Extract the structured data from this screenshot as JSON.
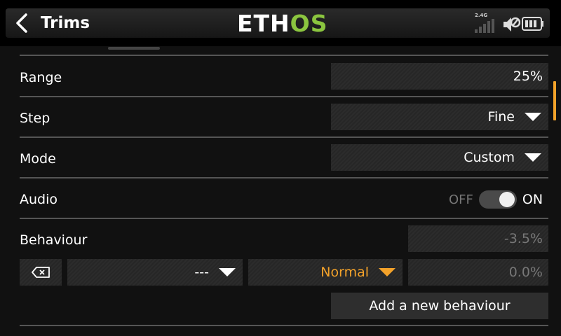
{
  "header": {
    "title": "Trims",
    "logo_eth": "ETH",
    "logo_os": "OS",
    "signal_label": "2.4G",
    "back_icon": "chevron-left-icon",
    "speaker_icon": "speaker-muted-icon",
    "battery_icon": "battery-icon"
  },
  "rows": {
    "range": {
      "label": "Range",
      "value": "25%"
    },
    "step": {
      "label": "Step",
      "value": "Fine"
    },
    "mode": {
      "label": "Mode",
      "value": "Custom"
    },
    "audio": {
      "label": "Audio",
      "off_label": "OFF",
      "on_label": "ON",
      "state": "on"
    },
    "behaviour": {
      "label": "Behaviour",
      "top_value": "-3.5%",
      "source_value": "---",
      "type_value": "Normal",
      "offset_value": "0.0%",
      "delete_icon": "delete-icon",
      "add_label": "Add a new behaviour"
    }
  },
  "colors": {
    "accent_orange": "#f3a22a",
    "logo_green": "#8bc53f",
    "background": "#111111"
  }
}
